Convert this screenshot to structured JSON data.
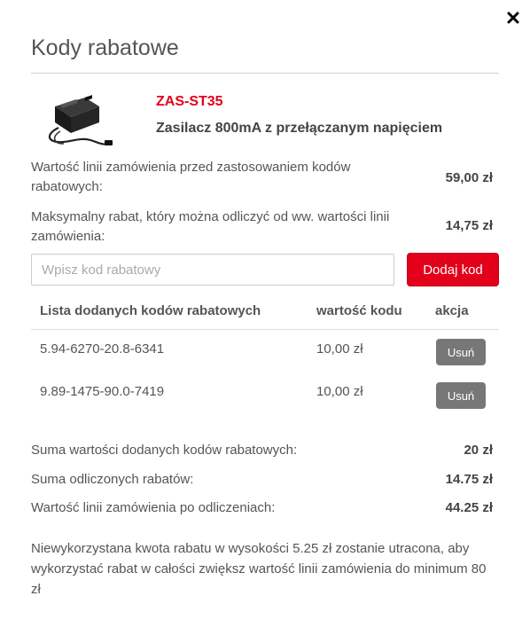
{
  "dialog": {
    "title": "Kody rabatowe",
    "close_icon": "close-icon"
  },
  "product": {
    "sku": "ZAS-ST35",
    "name": "Zasilacz 800mA z przełączanym napięciem",
    "image_icon": "power-adapter-image"
  },
  "order_info": {
    "value_before_label": "Wartość linii zamówienia przed zastosowaniem kodów rabatowych:",
    "value_before": "59,00 zł",
    "max_discount_label": "Maksymalny rabat, który można odliczyć od ww. wartości linii zamówienia:",
    "max_discount": "14,75 zł"
  },
  "code_form": {
    "placeholder": "Wpisz kod rabatowy",
    "value": "",
    "add_button": "Dodaj kod"
  },
  "codes_table": {
    "headers": {
      "code": "Lista dodanych kodów rabatowych",
      "value": "wartość kodu",
      "action": "akcja"
    },
    "rows": [
      {
        "code": "5.94-6270-20.8-6341",
        "value": "10,00 zł",
        "action": "Usuń"
      },
      {
        "code": "9.89-1475-90.0-7419",
        "value": "10,00 zł",
        "action": "Usuń"
      }
    ]
  },
  "summary": {
    "sum_codes_label": "Suma wartości dodanych kodów rabatowych:",
    "sum_codes": "20 zł",
    "sum_discounts_label": "Suma odliczonych rabatów:",
    "sum_discounts": "14.75 zł",
    "value_after_label": "Wartość linii zamówienia po odliczeniach:",
    "value_after": "44.25 zł"
  },
  "note": "Niewykorzystana kwota rabatu w wysokości 5.25 zł zostanie utracona, aby wykorzystać rabat w całości zwiększ wartość linii zamówienia do minimum 80 zł",
  "colors": {
    "accent": "#e2001a",
    "remove_button": "#777777"
  }
}
